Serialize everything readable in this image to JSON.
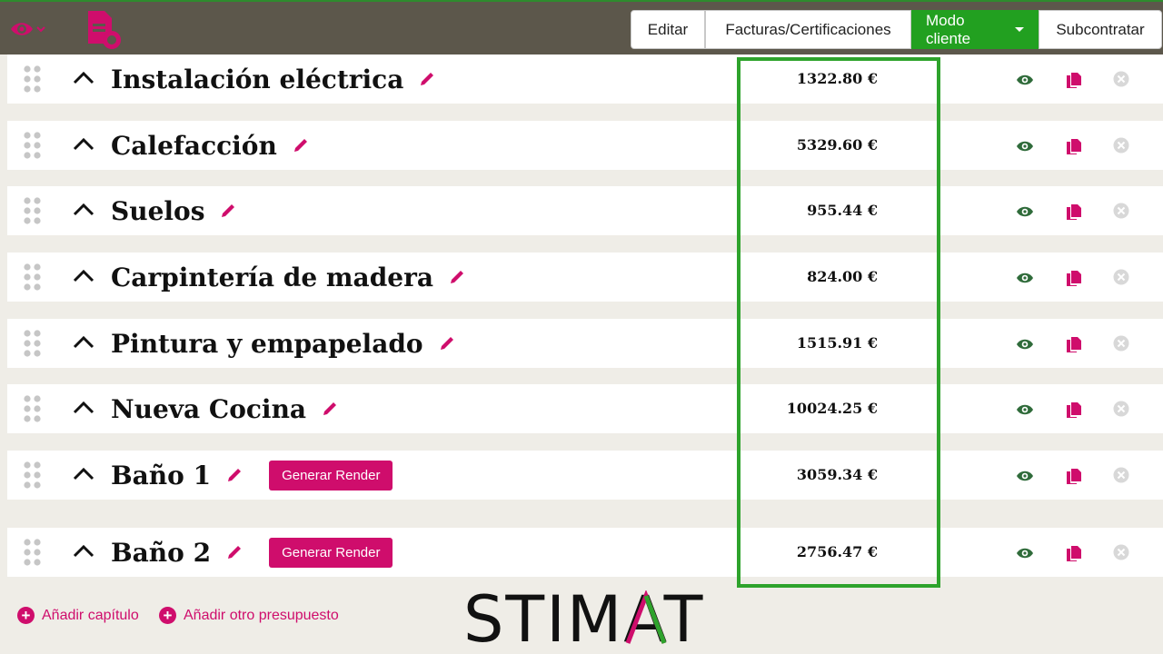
{
  "toolbar": {
    "buttons": [
      {
        "label": "Editar"
      },
      {
        "label": "Facturas/Certificaciones"
      },
      {
        "label": "Modo cliente",
        "active": true
      },
      {
        "label": "Subcontratar"
      }
    ]
  },
  "chapters": [
    {
      "title": "Instalación eléctrica",
      "amount": "1322.80 €"
    },
    {
      "title": "Calefacción",
      "amount": "5329.60 €"
    },
    {
      "title": "Suelos",
      "amount": "955.44 €"
    },
    {
      "title": "Carpintería de madera",
      "amount": "824.00 €"
    },
    {
      "title": "Pintura y empapelado",
      "amount": "1515.91 €"
    },
    {
      "title": "Nueva Cocina",
      "amount": "10024.25 €"
    },
    {
      "title": "Baño 1",
      "amount": "3059.34 €",
      "render_label": "Generar Render"
    },
    {
      "title": "Baño 2",
      "amount": "2756.47 €",
      "render_label": "Generar Render"
    }
  ],
  "footer": {
    "add_chapter": "Añadir capítulo",
    "add_budget": "Añadir otro presupuesto"
  },
  "logo": "STIMAT",
  "colors": {
    "brand": "#cf0d6c",
    "accent_green": "#22a020",
    "highlight": "#2ea32c",
    "eye_green": "#2f6b3a"
  },
  "icons": [
    "eye-icon",
    "document-icon",
    "drag-handle-icon",
    "chevron-up-icon",
    "pencil-icon",
    "copy-icon",
    "close-icon",
    "plus-circle-icon"
  ]
}
